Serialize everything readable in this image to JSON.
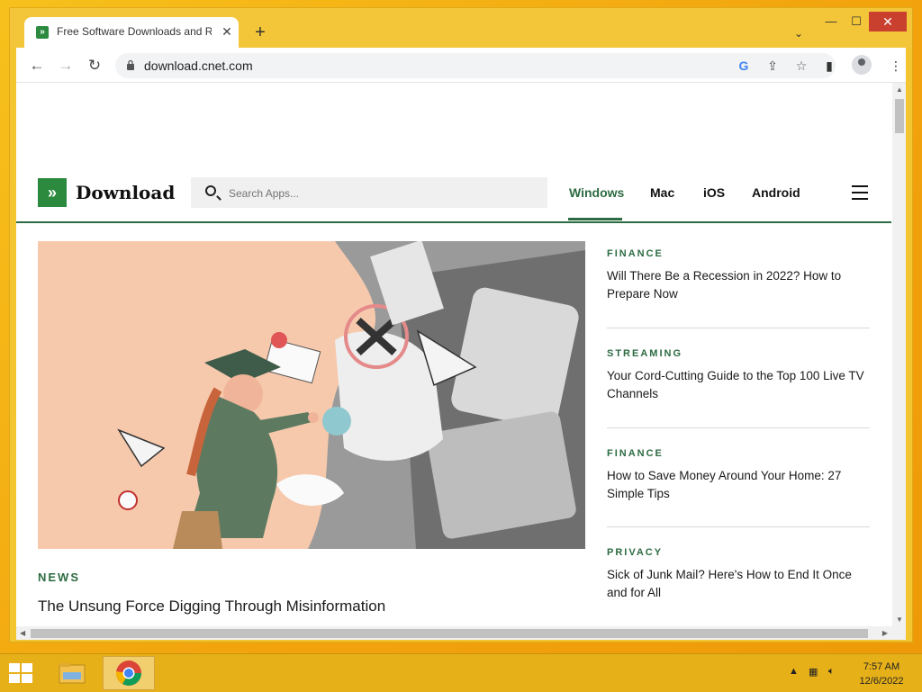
{
  "browser": {
    "tab_title": "Free Software Downloads and Re",
    "tab_close": "✕",
    "new_tab": "+",
    "url": "download.cnet.com",
    "window_min": "—",
    "window_max": "☐",
    "window_close": "✕"
  },
  "site": {
    "logo_text": "Download",
    "logo_mark": "»",
    "search_placeholder": "Search Apps...",
    "nav": [
      "Windows",
      "Mac",
      "iOS",
      "Android"
    ],
    "active_nav": "Windows",
    "accent_color": "#2d6b42"
  },
  "hero": {
    "label": "NEWS",
    "title": "The Unsung Force Digging Through Misinformation"
  },
  "sidebar": {
    "items": [
      {
        "category": "FINANCE",
        "title": "Will There Be a Recession in 2022? How to Prepare Now"
      },
      {
        "category": "STREAMING",
        "title": "Your Cord-Cutting Guide to the Top 100 Live TV Channels"
      },
      {
        "category": "FINANCE",
        "title": "How to Save Money Around Your Home: 27 Simple Tips"
      },
      {
        "category": "PRIVACY",
        "title": "Sick of Junk Mail? Here's How to End It Once and for All"
      }
    ]
  },
  "taskbar": {
    "time": "7:57 AM",
    "date": "12/6/2022"
  }
}
